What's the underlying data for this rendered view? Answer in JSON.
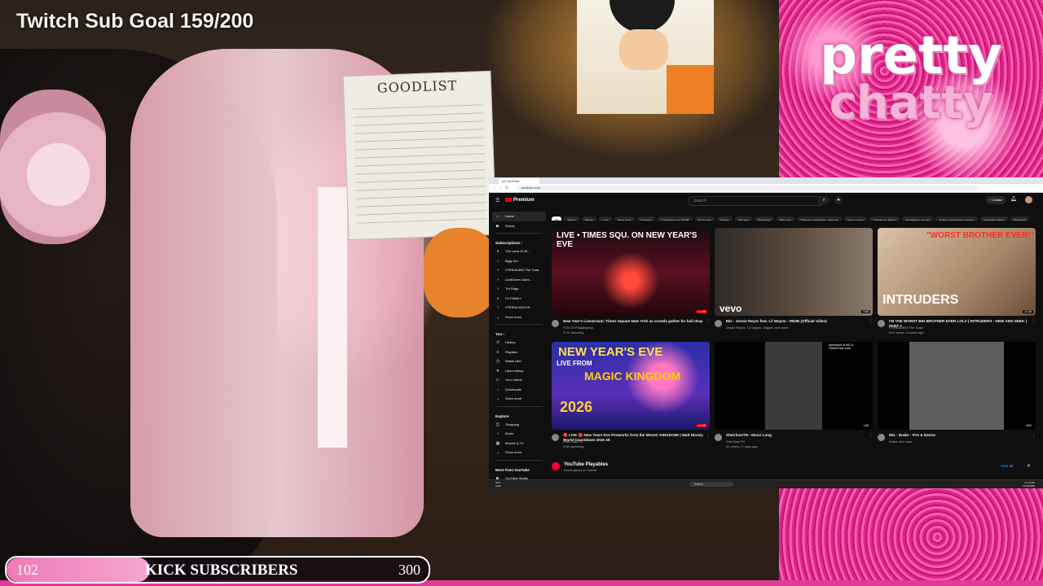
{
  "overlay": {
    "sub_goal_text": "Twitch Sub Goal 159/200",
    "kick_bar": {
      "start": "102",
      "label": "KICK SUBSCRIBERS",
      "end": "300",
      "fill_fraction": 0.34
    },
    "brand_logo": [
      "pretty",
      "chatty"
    ]
  },
  "webcam": {
    "whiteboard_title": "GOODLIST"
  },
  "browser": {
    "tab_title": "(2) YouTube",
    "url": "youtube.com",
    "youtube": {
      "logo": "Premium",
      "search_placeholder": "Search",
      "create_label": "+ Create",
      "chips": [
        "All",
        "Music",
        "Mixes",
        "Live",
        "New Year",
        "Gaming",
        "Contemporary R&B",
        "Podcasts",
        "Drake",
        "Albums",
        "Rhythms",
        "Sitcoms",
        "Chinese television dramas",
        "Free music",
        "Christmas Music",
        "Meditation music",
        "Action-adventure games",
        "Animated films",
        "Recently"
      ],
      "sidebar": {
        "main": [
          {
            "icon": "home-icon",
            "glyph": "⌂",
            "label": "Home"
          },
          {
            "icon": "shorts-icon",
            "glyph": "▶",
            "label": "Shorts"
          }
        ],
        "subscriptions_heading": "Subscriptions ›",
        "subscriptions": [
          "The Land Of Bl...",
          "Bigg Juh",
          "ITSREALBIG The Goat",
          "LeafGreen Gami...",
          "Tre Rage",
          "FV FAMILY",
          "ITSREALKEVOS",
          "Show more"
        ],
        "you_heading": "You ›",
        "you": [
          {
            "icon": "history-icon",
            "glyph": "↺",
            "label": "History"
          },
          {
            "icon": "playlists-icon",
            "glyph": "≡",
            "label": "Playlists"
          },
          {
            "icon": "watch-later-icon",
            "glyph": "◷",
            "label": "Watch later"
          },
          {
            "icon": "liked-icon",
            "glyph": "♥",
            "label": "Liked videos"
          },
          {
            "icon": "your-videos-icon",
            "glyph": "▷",
            "label": "Your videos"
          },
          {
            "icon": "downloads-icon",
            "glyph": "↓",
            "label": "Downloads"
          },
          {
            "icon": "show-more-icon",
            "glyph": "⌄",
            "label": "Show more"
          }
        ],
        "explore_heading": "Explore",
        "explore": [
          {
            "icon": "shopping-icon",
            "glyph": "◫",
            "label": "Shopping"
          },
          {
            "icon": "music-icon",
            "glyph": "♪",
            "label": "Music"
          },
          {
            "icon": "movies-icon",
            "glyph": "▦",
            "label": "Movies & TV"
          },
          {
            "icon": "show-more-icon",
            "glyph": "⌄",
            "label": "Show more"
          }
        ],
        "more_heading": "More from YouTube",
        "more": [
          {
            "icon": "youtube-studio-icon",
            "glyph": "▶",
            "label": "YouTube Studio"
          }
        ]
      },
      "videos": [
        {
          "thumb_text": "LIVE • TIMES SQU. ON NEW YEAR'S EVE",
          "badge": "• LIVE",
          "title": "New Year's Livestream: Times Square New York as crowds gather for ball drop",
          "channel": "FOX 29 Philadelphia",
          "stats": "3.7K watching"
        },
        {
          "thumb_text": "vevo",
          "badge": "3:56",
          "title": "Mix - Jessie Reyez feat. Lil Wayne - RIDIN (Official Video)",
          "channel": "Jessie Reyez, Lil Wayne, Miguel, and more",
          "stats": ""
        },
        {
          "thumb_text": "\"WORST BROTHER EVER!\"",
          "thumb_text2": "INTRUDERS",
          "badge": "21:38",
          "title": "I'M THE WORST BIG BROTHER EVER LOL!! | INTRUDERS - HIDE AND SEEK | PART 1",
          "channel": "ITSREALBIG The Goat",
          "stats": "61K views • 6 years ago"
        },
        {
          "thumb_text": "NEW YEAR'S EVE",
          "thumb_text2": "LIVE FROM",
          "thumb_text3": "MAGIC KINGDOM",
          "thumb_text4": "2026",
          "badge": "• LIVE",
          "title": "🔴 LIVE 🔴 New Years Eve Fireworks from the MAGIC KINGDOM! | Walt Disney World Countdown 2026 4K",
          "channel": "Park Pass TV",
          "stats": "6.6K watching"
        },
        {
          "thumb_text": "Uploaded in HD @ TwitchTube.com",
          "badge": "1:55",
          "title": "SheCloseTN - Murci Long",
          "channel": "SheCloseTN",
          "stats": "22 views • 2 days ago"
        },
        {
          "thumb_text": "",
          "badge": "MIX",
          "title": "Mix - Drake - Fire & Desire",
          "channel": "Drake and more",
          "stats": ""
        }
      ],
      "playables": {
        "title": "YouTube Playables",
        "subtitle": "Instant games on Youtube",
        "view_all": "View all",
        "close": "✕"
      }
    },
    "taskbar": {
      "weather": "50°F\nClear",
      "search": "Search",
      "time": "11:44 PM\n12/31/2025"
    }
  },
  "colors": {
    "youtube_red": "#ff0000",
    "kick_bar_pink": "#f07ab7",
    "overlay_pink": "#e0248a"
  }
}
